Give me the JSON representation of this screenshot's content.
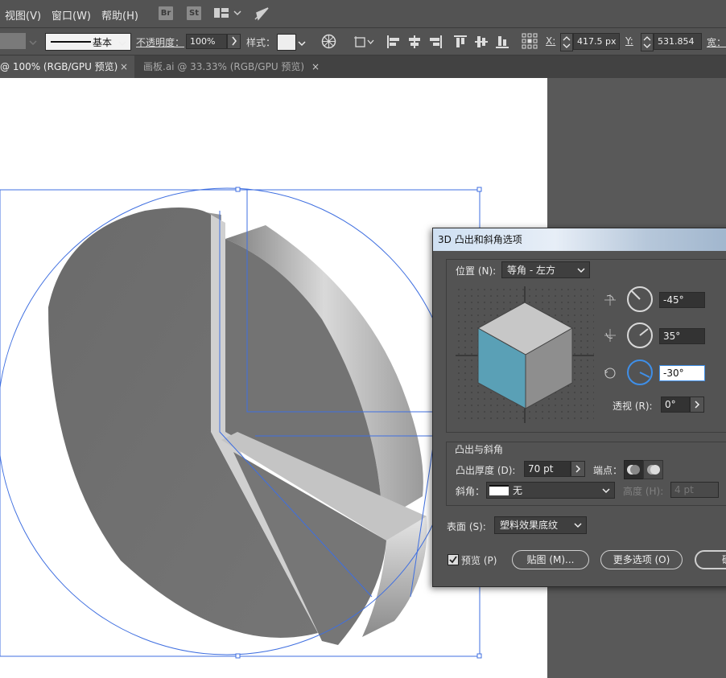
{
  "menu": {
    "view": "视图(V)",
    "window": "窗口(W)",
    "help": "帮助(H)",
    "bridge": "Br",
    "stock": "St"
  },
  "control": {
    "stroke_style": "基本",
    "opacity_label": "不透明度：",
    "opacity_value": "100%",
    "style_label": "样式：",
    "x_label": "X:",
    "x_value": "417.5 px",
    "y_label": "Y:",
    "y_value": "531.854",
    "width_label": "宽："
  },
  "tabs": [
    {
      "label": "@ 100% (RGB/GPU 预览)",
      "close": "×"
    },
    {
      "label": "画板.ai @ 33.33% (RGB/GPU 预览)",
      "close": "×"
    }
  ],
  "dialog": {
    "title": "3D 凸出和斜角选项",
    "position_label": "位置 (N):",
    "position_value": "等角 - 左方",
    "rot_x": "-45°",
    "rot_y": "35°",
    "rot_z": "-30°",
    "perspective_label": "透视 (R):",
    "perspective_value": "0°",
    "extrude_section": "凸出与斜角",
    "extrude_depth_label": "凸出厚度 (D):",
    "extrude_depth_value": "70 pt",
    "cap_label": "端点：",
    "bevel_label": "斜角：",
    "bevel_value": "无",
    "height_label": "高度 (H):",
    "height_value": "4 pt",
    "surface_label": "表面 (S):",
    "surface_value": "塑料效果底纹",
    "preview_label": "预览 (P)",
    "map_art_button": "贴图 (M)...",
    "more_options_button": "更多选项 (O)",
    "ok_button": "确"
  },
  "colors": {
    "accent_blue": "#3f6fe0",
    "cube_side": "#5aa0b6",
    "pie_gray": "#7a7a7a"
  }
}
